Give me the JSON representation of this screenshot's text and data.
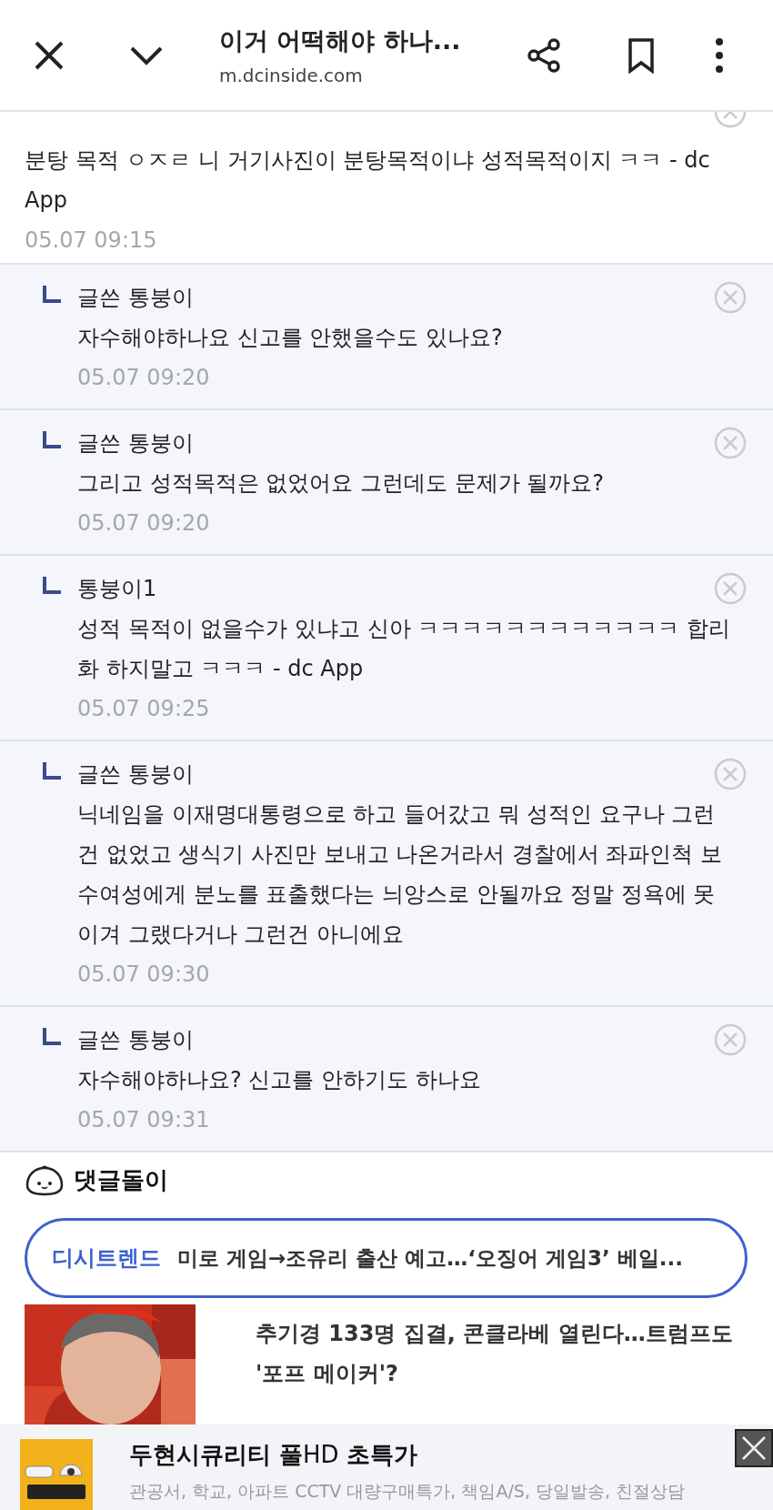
{
  "header": {
    "title": "이거 어떡해야 하나...",
    "url": "m.dcinside.com"
  },
  "comments": [
    {
      "kind": "comment",
      "text": "분탕 목적 ㅇㅈㄹ 니 거기사진이 분탕목적이냐 성적목적이지 ㅋㅋ - dc App",
      "date": "05.07 09:15"
    },
    {
      "kind": "reply",
      "author": "글쓴 통붕이",
      "text": "자수해야하나요 신고를 안했을수도 있나요?",
      "date": "05.07 09:20"
    },
    {
      "kind": "reply",
      "author": "글쓴 통붕이",
      "text": "그리고 성적목적은 없었어요 그런데도 문제가 될까요?",
      "date": "05.07 09:20"
    },
    {
      "kind": "reply",
      "author": "통붕이1",
      "text": "성적 목적이 없을수가 있냐고 신아 ㅋㅋㅋㅋㅋㅋㅋㅋㅋㅋㅋㅋ 합리화 하지말고 ㅋㅋㅋ - dc App",
      "date": "05.07 09:25"
    },
    {
      "kind": "reply",
      "author": "글쓴 통붕이",
      "text": "닉네임을 이재명대통령으로 하고 들어갔고 뭐 성적인 요구나 그런건 없었고 생식기 사진만 보내고 나온거라서 경찰에서 좌파인척 보수여성에게 분노를 표출했다는 늬앙스로 안될까요 정말 정욕에 못이겨 그랬다거나 그런건 아니에요",
      "date": "05.07 09:30"
    },
    {
      "kind": "reply",
      "author": "글쓴 통붕이",
      "text": "자수해야하나요? 신고를 안하기도 하나요",
      "date": "05.07 09:31"
    }
  ],
  "comment_bot": {
    "label": "댓글돌이"
  },
  "trend": {
    "tag": "디시트렌드",
    "headline": "미로 게임→조유리 출산 예고…‘오징어 게임3’ 베일..."
  },
  "news": [
    {
      "kind": "picture",
      "headline": "추기경 133명 집결, 콘클라베 열린다…트럼프도 '포프 메이커'?"
    }
  ],
  "ad": {
    "title": "**두현시큐리티 풀**HD **초특가**",
    "subtitle": "관공서, 학교, 아파트 CCTV 대량구매특가, 책임A/S, 당일발송, 친절상담"
  }
}
